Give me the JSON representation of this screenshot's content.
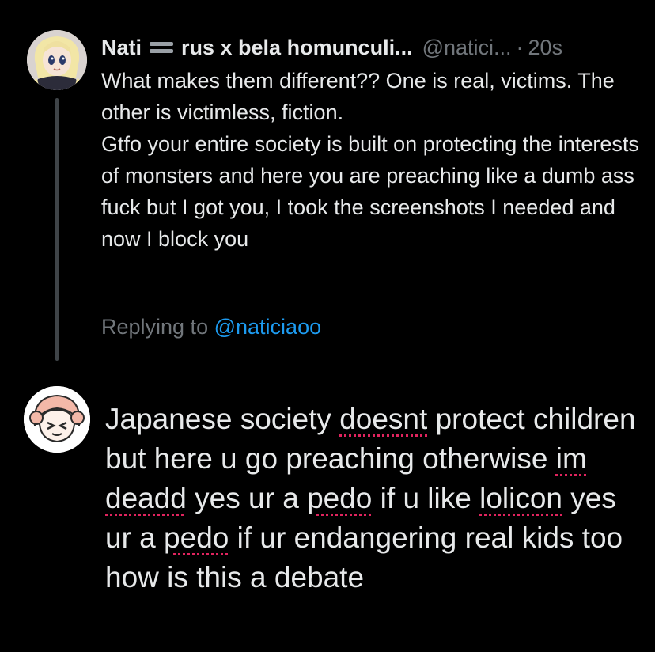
{
  "colors": {
    "background": "#000000",
    "primary_text": "#e7e9ea",
    "secondary_text": "#71767b",
    "link": "#1d9bf0",
    "spellcheck_underline": "#e0245e",
    "thread_line": "#3f4448"
  },
  "tweet": {
    "display_name_first": "Nati",
    "display_name_flag_icon": "flag-icon",
    "display_name_rest": "rus x bela homunculi...",
    "handle": "@natici...",
    "separator": "·",
    "time": "20s",
    "text": "What makes them different?? One is real, victims. The other is victimless, fiction.\nGtfo your entire society is built on protecting the interests of monsters and here you are preaching like a dumb ass fuck but I got you, I took the screenshots I needed and now I block you",
    "replying_prefix": "Replying to",
    "replying_handle": "@naticiaoo"
  },
  "reply_draft": {
    "segments": [
      "Japanese society ",
      "doesnt",
      " protect children but here u go preaching otherwise ",
      "im",
      " ",
      "deadd",
      " yes ur a ",
      "pedo",
      " if u like ",
      "lolicon",
      " yes ur a ",
      "pedo",
      " if ur endangering real kids too how is this a debate"
    ]
  }
}
